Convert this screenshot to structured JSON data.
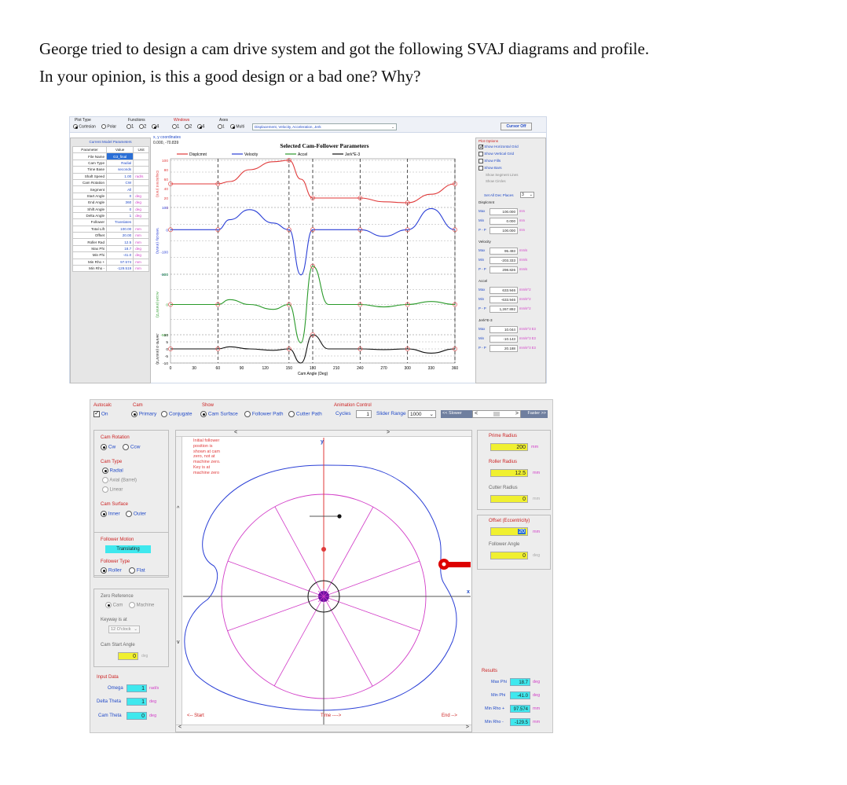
{
  "question": {
    "line1": "George tried to design a cam drive system and got the following SVAJ diagrams and profile.",
    "line2": "In your opinion, is this a good design or a bad one? Why?"
  },
  "svaj": {
    "toolbar": {
      "plot_type_label": "Plot Type",
      "cartesian": "Cartesian",
      "polar": "Polar",
      "functions_label": "Functions",
      "functions_opts": [
        "1",
        "2",
        "4"
      ],
      "windows_label": "Windows",
      "windows_opts": [
        "1",
        "2",
        "4"
      ],
      "axes_label": "Axes",
      "axes_opts": [
        "1",
        "Multi"
      ],
      "plot_select": "Displacement, Velocity, Acceleration, Jerk",
      "cursor_btn": "Cursor Off"
    },
    "params": {
      "title": "Current Model Parameters",
      "headers": [
        "Parameter",
        "Value",
        "Unit"
      ],
      "rows": [
        [
          "File Name",
          "G3_final",
          ""
        ],
        [
          "Cam Type",
          "Radial",
          ""
        ],
        [
          "Time Base",
          "seconds",
          ""
        ],
        [
          "Shaft Speed",
          "1.00",
          "rad/s"
        ],
        [
          "Cam Rotation",
          "CW",
          ""
        ],
        [
          "Segment",
          "All",
          ""
        ],
        [
          "Start Angle",
          "0",
          "deg"
        ],
        [
          "End Angle",
          "360",
          "deg"
        ],
        [
          "Shift Angle",
          "0",
          "deg"
        ],
        [
          "Delta Angle",
          "1",
          "deg"
        ],
        [
          "Follower",
          "Translates",
          ""
        ],
        [
          "Total Lift",
          "100.00",
          "mm"
        ],
        [
          "Offset",
          "20.00",
          "mm"
        ],
        [
          "Roller Rad",
          "12.5",
          "mm"
        ],
        [
          "Max Phi",
          "18.7",
          "deg"
        ],
        [
          "Min Phi",
          "-41.0",
          "deg"
        ],
        [
          "Min Rho +",
          "97.574",
          "mm"
        ],
        [
          "Min Rho -",
          "-129.519",
          "mm"
        ]
      ]
    },
    "coords": {
      "label": "x, y coordinates",
      "value": "0.000, -70.839"
    },
    "chart_title": "Selected Cam-Follower Parameters",
    "legend": [
      "Displcmnt",
      "Velocity",
      "Accel",
      "Jerk*E-3"
    ],
    "axis_titles": [
      "Displcmnt (mm)",
      "Velocity (mm/s)",
      "Accel (mm/s^2)",
      "Jerk*E-3 (mm/s^3)"
    ],
    "xlabel": "Cam Angle (Deg)",
    "xticks": [
      "0",
      "30",
      "60",
      "90",
      "120",
      "150",
      "180",
      "210",
      "240",
      "270",
      "300",
      "330",
      "360"
    ],
    "yticks_disp": [
      "100",
      "80",
      "60",
      "40",
      "20",
      "0"
    ],
    "yticks_vel": [
      "100",
      "0",
      "-100",
      "-200"
    ],
    "yticks_acc": [
      "500",
      "0",
      "-500"
    ],
    "yticks_jerk": [
      "10",
      "5",
      "0",
      "-5",
      "-10"
    ],
    "options": {
      "title": "Plot Options",
      "checks": [
        {
          "label": "Show Horizontal Grid",
          "on": true
        },
        {
          "label": "Show Vertical Grid",
          "on": false
        },
        {
          "label": "Show Fills",
          "on": false
        },
        {
          "label": "Show Bars",
          "on": false
        }
      ],
      "gray_checks": [
        "Show Segment Lines",
        "Show Circles"
      ],
      "dec_label": "Set All Dec Places",
      "dec_value": "3",
      "groups": [
        {
          "name": "Displcmnt",
          "rows": [
            [
              "Max",
              "100.000",
              "mm"
            ],
            [
              "Min",
              "0.000",
              "mm"
            ],
            [
              "P - P",
              "100.000",
              "mm"
            ]
          ]
        },
        {
          "name": "Velocity",
          "rows": [
            [
              "Max",
              "95.493",
              "mm/s"
            ],
            [
              "Min",
              "-203.333",
              "mm/s"
            ],
            [
              "P - P",
              "298.826",
              "mm/s"
            ]
          ]
        },
        {
          "name": "Accel",
          "rows": [
            [
              "Max",
              "633.946",
              "mm/s^2"
            ],
            [
              "Min",
              "-633.946",
              "mm/s^2"
            ],
            [
              "P - P",
              "1,267.892",
              "mm/s^2"
            ]
          ]
        },
        {
          "name": "Jerk*E-3",
          "rows": [
            [
              "Max",
              "10.044",
              "mm/s^3 E3"
            ],
            [
              "Min",
              "-10.143",
              "mm/s^3 E3"
            ],
            [
              "P - P",
              "20.188",
              "mm/s^3 E3"
            ]
          ]
        }
      ]
    }
  },
  "chart_data": {
    "type": "line",
    "title": "Selected Cam-Follower Parameters",
    "xlabel": "Cam Angle (Deg)",
    "xlim": [
      0,
      360
    ],
    "x": [
      0,
      60,
      75,
      100,
      130,
      150,
      165,
      180,
      200,
      240,
      270,
      300,
      330,
      360
    ],
    "series": [
      {
        "name": "Displcmnt",
        "values": [
          50,
          50,
          55,
          80,
          97,
          100,
          60,
          20,
          20,
          20,
          12,
          10,
          28,
          50
        ],
        "ylim": [
          0,
          100
        ]
      },
      {
        "name": "Velocity",
        "values": [
          0,
          0,
          45,
          90,
          30,
          0,
          -203,
          0,
          0,
          0,
          -30,
          0,
          95,
          0
        ],
        "ylim": [
          -200,
          100
        ]
      },
      {
        "name": "Accel",
        "values": [
          0,
          0,
          80,
          0,
          -80,
          0,
          -633,
          634,
          0,
          0,
          -40,
          0,
          50,
          0
        ],
        "ylim": [
          -500,
          500
        ]
      },
      {
        "name": "Jerk*E-3",
        "values": [
          0,
          0,
          1.5,
          0,
          -1,
          0,
          -10,
          10,
          0,
          0,
          -0.5,
          0,
          -3,
          0
        ],
        "ylim": [
          -10,
          10
        ]
      }
    ]
  },
  "profile": {
    "autocalc_label": "Autocalc",
    "on_label": "On",
    "cam_label": "Cam",
    "primary": "Primary",
    "conjugate": "Conjugate",
    "show_label": "Show",
    "cam_surface": "Cam Surface",
    "follower_path": "Follower Path",
    "cutter_path": "Cutter Path",
    "anim_label": "Animation Control",
    "cycles_label": "Cycles",
    "cycles_value": "1",
    "slider_label": "Slider Range",
    "slider_value": "1000",
    "slower": "<< Slower",
    "faster": "Faster >>",
    "left": {
      "cam_rotation": "Cam Rotation",
      "cw": "Cw",
      "ccw": "Ccw",
      "cam_type": "Cam Type",
      "radial": "Radial",
      "axial": "Axial (Barrel)",
      "linear": "Linear",
      "cam_surface": "Cam Surface",
      "inner": "Inner",
      "outer": "Outer",
      "follower_motion": "Follower Motion",
      "translating": "Translating",
      "follower_type": "Follower Type",
      "roller": "Roller",
      "flat": "Flat",
      "zero_ref": "Zero Reference",
      "cam": "Cam",
      "machine": "Machine",
      "keyway_label": "Keyway is at",
      "keyway_value": "12 O'clock",
      "cam_start": "Cam Start Angle",
      "cam_start_value": "0",
      "deg": "deg",
      "input_data": "Input Data",
      "omega": "Omega",
      "omega_value": "1",
      "omega_unit": "rad/s",
      "delta_theta": "Delta Theta",
      "delta_theta_value": "1",
      "delta_theta_unit": "deg",
      "cam_theta": "Cam Theta",
      "cam_theta_value": "0",
      "cam_theta_unit": "deg"
    },
    "note": [
      "Initial follower",
      "position is",
      "shown at cam",
      "zero, not at",
      "machine zero.",
      "Key is at",
      "machine zero"
    ],
    "axis_x": "x",
    "axis_y": "y",
    "start": "<-- Start",
    "time": "Time ---->",
    "end": "End -->",
    "right": {
      "prime_radius": "Prime Radius",
      "prime_value": "200",
      "mm": "mm",
      "roller_radius": "Roller Radius",
      "roller_value": "12.5",
      "cutter_radius": "Cutter Radius",
      "cutter_value": "0",
      "offset": "Offset (Eccentricity)",
      "offset_value": "20",
      "follower_angle": "Follower Angle",
      "follower_angle_value": "0",
      "deg": "deg",
      "results": "Results",
      "rows": [
        [
          "Max Phi",
          "18.7",
          "deg"
        ],
        [
          "Min Phi",
          "-41.0",
          "deg"
        ],
        [
          "Min Rho +",
          "97.574",
          "mm"
        ],
        [
          "Min Rho -",
          "-129.5",
          "mm"
        ]
      ]
    }
  },
  "colors": {
    "displ": "#e03a3a",
    "vel": "#2a3fd6",
    "acc": "#2a9a2a",
    "jerk": "#111111",
    "pink": "#d23ec8"
  }
}
